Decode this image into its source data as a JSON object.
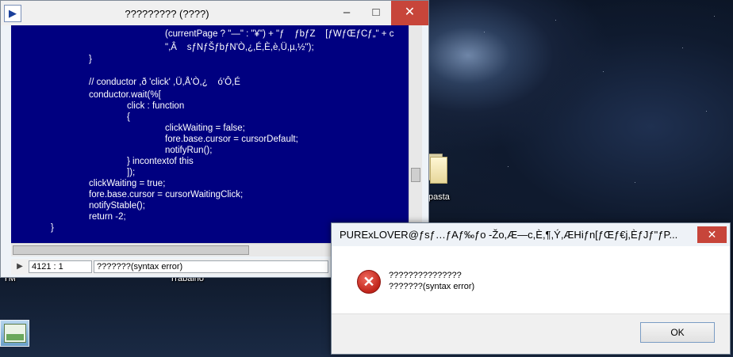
{
  "desktop": {
    "labels": [
      "pasta",
      "TM",
      "Trabalho"
    ]
  },
  "editor": {
    "title": "????????? (????)",
    "buttons": {
      "minimize": "–",
      "maximize": "□",
      "close": "✕"
    },
    "code_lines": [
      "(currentPage ? \"—\" : \"¥\") + \"ƒ    ƒbƒZ    [ƒWƒŒƒCƒ„\" + c",
      "\",Â    sƒNƒŠƒbƒN'Ò,¿,É,È,è,Ü,µ,½\");",
      "}",
      "",
      "// conductor ,ð 'click' ,Ü,Å'Ò,¿    ó'Ô,É",
      "conductor.wait(%[",
      "click : function",
      "{",
      "clickWaiting = false;",
      "fore.base.cursor = cursorDefault;",
      "notifyRun();",
      "} incontextof this",
      "]);",
      "clickWaiting = true;",
      "fore.base.cursor = cursorWaitingClick;",
      "notifyStable();",
      "return -2;",
      "}"
    ],
    "status": {
      "position": "4121 : 1",
      "message": "???????(syntax error)"
    }
  },
  "dialog": {
    "title": "PURExLOVER@ƒsƒ…ƒAƒ‰ƒo -Žo,Æ—c,È,¶,Ý,ÆHiƒn[ƒŒƒ€j,ÈƒJƒ\"ƒP...",
    "close": "✕",
    "message_line1": "???????????????",
    "message_line2": "???????(syntax error)",
    "ok_label": "OK"
  }
}
